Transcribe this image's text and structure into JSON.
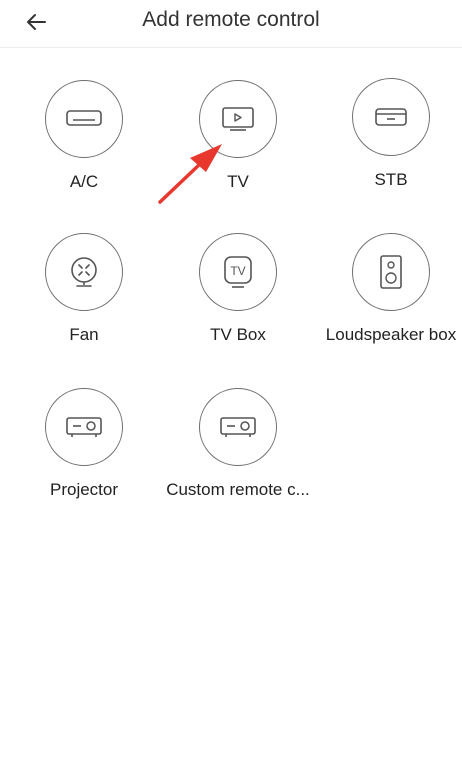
{
  "header": {
    "back_icon": "arrow-left-icon",
    "title": "Add remote control"
  },
  "devices": [
    {
      "label": "A/C",
      "icon": "air-conditioner-icon"
    },
    {
      "label": "TV",
      "icon": "tv-icon"
    },
    {
      "label": "STB",
      "icon": "set-top-box-icon"
    },
    {
      "label": "Fan",
      "icon": "fan-icon"
    },
    {
      "label": "TV Box",
      "icon": "tv-box-icon"
    },
    {
      "label": "Loudspeaker box",
      "icon": "speaker-icon"
    },
    {
      "label": "Projector",
      "icon": "projector-icon"
    },
    {
      "label": "Custom remote c...",
      "icon": "custom-remote-icon"
    }
  ],
  "colors": {
    "icon_stroke": "#555555",
    "annotation_arrow": "#e8382d"
  }
}
